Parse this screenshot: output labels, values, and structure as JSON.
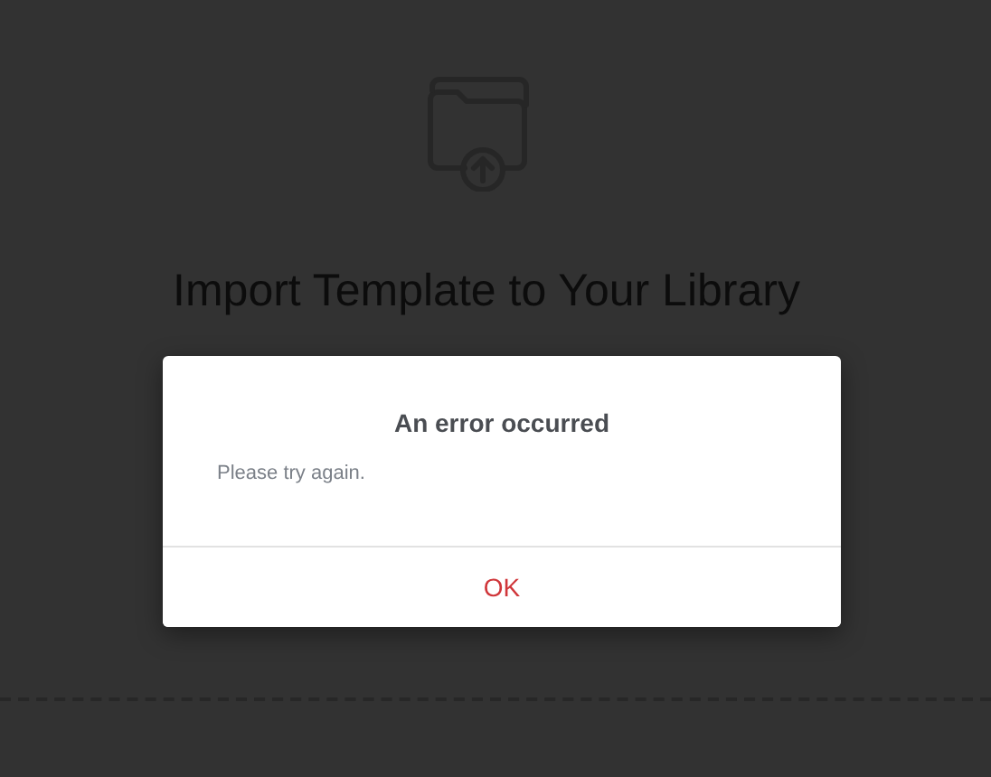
{
  "page": {
    "heading": "Import Template to Your Library"
  },
  "dialog": {
    "title": "An error occurred",
    "message": "Please try again.",
    "button": "OK"
  }
}
